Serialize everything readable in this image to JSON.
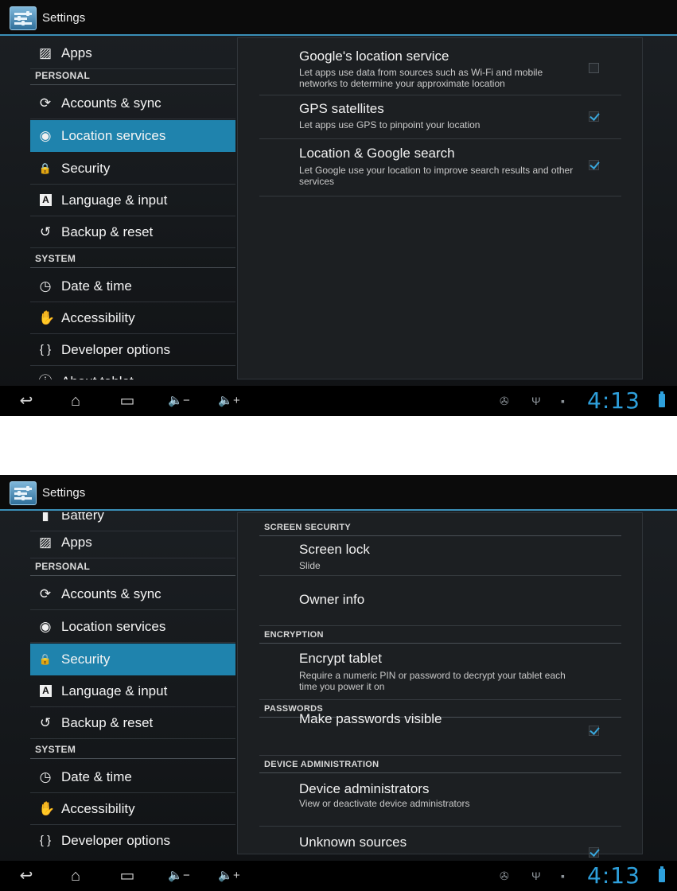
{
  "shots": [
    {
      "title": "Settings",
      "nav": [
        {
          "type": "item",
          "label": "Apps",
          "icon": "apps-icon",
          "glyph": "▨"
        },
        {
          "type": "section",
          "label": "PERSONAL"
        },
        {
          "type": "item",
          "label": "Accounts & sync",
          "icon": "sync-icon",
          "glyph": "⟳"
        },
        {
          "type": "item",
          "label": "Location services",
          "icon": "location-icon",
          "glyph": "◉",
          "active": true
        },
        {
          "type": "item",
          "label": "Security",
          "icon": "lock-icon",
          "glyph": "🔒"
        },
        {
          "type": "item",
          "label": "Language & input",
          "icon": "keyboard-a-icon",
          "glyph": "A"
        },
        {
          "type": "item",
          "label": "Backup & reset",
          "icon": "restore-icon",
          "glyph": "↺"
        },
        {
          "type": "section",
          "label": "SYSTEM"
        },
        {
          "type": "item",
          "label": "Date & time",
          "icon": "clock-icon",
          "glyph": "◷"
        },
        {
          "type": "item",
          "label": "Accessibility",
          "icon": "hand-icon",
          "glyph": "✋"
        },
        {
          "type": "item",
          "label": "Developer options",
          "icon": "braces-icon",
          "glyph": "{ }"
        },
        {
          "type": "item",
          "label": "About tablet",
          "icon": "info-icon",
          "glyph": "ⓘ"
        }
      ],
      "detail": [
        {
          "type": "pref",
          "title": "Google's location service",
          "summary": "Let apps use data from sources such as Wi-Fi and mobile networks to determine your approximate location",
          "checkbox": "off"
        },
        {
          "type": "pref",
          "title": "GPS satellites",
          "summary": "Let apps use GPS to pinpoint your location",
          "checkbox": "on"
        },
        {
          "type": "pref",
          "title": "Location & Google search",
          "summary": "Let Google use your location to improve search results and other services",
          "checkbox": "on"
        }
      ],
      "status": {
        "time": "4:13",
        "icons": [
          "debug-icon",
          "usb-icon",
          "sd-card-icon"
        ]
      }
    },
    {
      "title": "Settings",
      "nav": [
        {
          "type": "item",
          "label": "Battery",
          "icon": "battery-icon",
          "glyph": "▮"
        },
        {
          "type": "item",
          "label": "Apps",
          "icon": "apps-icon",
          "glyph": "▨"
        },
        {
          "type": "section",
          "label": "PERSONAL"
        },
        {
          "type": "item",
          "label": "Accounts & sync",
          "icon": "sync-icon",
          "glyph": "⟳"
        },
        {
          "type": "item",
          "label": "Location services",
          "icon": "location-icon",
          "glyph": "◉"
        },
        {
          "type": "item",
          "label": "Security",
          "icon": "lock-icon",
          "glyph": "🔒",
          "active": true
        },
        {
          "type": "item",
          "label": "Language & input",
          "icon": "keyboard-a-icon",
          "glyph": "A"
        },
        {
          "type": "item",
          "label": "Backup & reset",
          "icon": "restore-icon",
          "glyph": "↺"
        },
        {
          "type": "section",
          "label": "SYSTEM"
        },
        {
          "type": "item",
          "label": "Date & time",
          "icon": "clock-icon",
          "glyph": "◷"
        },
        {
          "type": "item",
          "label": "Accessibility",
          "icon": "hand-icon",
          "glyph": "✋"
        },
        {
          "type": "item",
          "label": "Developer options",
          "icon": "braces-icon",
          "glyph": "{ }"
        }
      ],
      "detail": [
        {
          "type": "section",
          "label": "SCREEN SECURITY"
        },
        {
          "type": "pref",
          "title": "Screen lock",
          "summary": "Slide"
        },
        {
          "type": "pref",
          "title": "Owner info",
          "summary": ""
        },
        {
          "type": "section",
          "label": "ENCRYPTION"
        },
        {
          "type": "pref",
          "title": "Encrypt tablet",
          "summary": "Require a numeric PIN or password to decrypt your tablet each time you power it on"
        },
        {
          "type": "section",
          "label": "PASSWORDS"
        },
        {
          "type": "pref",
          "title": "Make passwords visible",
          "summary": "",
          "checkbox": "on"
        },
        {
          "type": "section",
          "label": "DEVICE ADMINISTRATION"
        },
        {
          "type": "pref",
          "title": "Device administrators",
          "summary": "View or deactivate device administrators"
        },
        {
          "type": "pref",
          "title": "Unknown sources",
          "summary": "",
          "checkbox": "on"
        }
      ],
      "status": {
        "time": "4:13",
        "icons": [
          "debug-icon",
          "usb-icon",
          "sd-card-icon"
        ]
      }
    }
  ],
  "navbar_buttons": [
    {
      "name": "back-button",
      "glyph": "↩"
    },
    {
      "name": "home-button",
      "glyph": "⌂"
    },
    {
      "name": "recent-apps-button",
      "glyph": "▭"
    },
    {
      "name": "volume-down-button",
      "glyph": "🔈−"
    },
    {
      "name": "volume-up-button",
      "glyph": "🔈+"
    }
  ]
}
